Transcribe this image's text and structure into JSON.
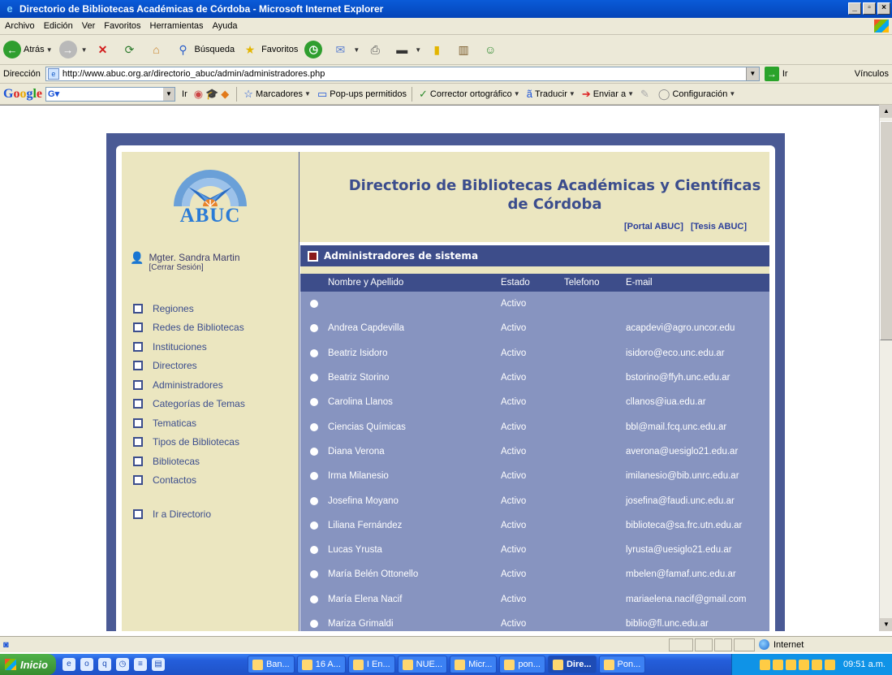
{
  "window": {
    "title": "Directorio de Bibliotecas Académicas de Córdoba - Microsoft Internet Explorer"
  },
  "menubar": [
    "Archivo",
    "Edición",
    "Ver",
    "Favoritos",
    "Herramientas",
    "Ayuda"
  ],
  "toolbar": {
    "back": "Atrás",
    "search": "Búsqueda",
    "favorites": "Favoritos"
  },
  "address": {
    "label": "Dirección",
    "url": "http://www.abuc.org.ar/directorio_abuc/admin/administradores.php",
    "go": "Ir",
    "links": "Vínculos"
  },
  "googlebar": {
    "go": "Ir",
    "bookmarks": "Marcadores",
    "popups": "Pop-ups permitidos",
    "spell": "Corrector ortográfico",
    "translate": "Traducir",
    "send": "Enviar a",
    "settings": "Configuración"
  },
  "site": {
    "logo_text": "ABUC",
    "title": "Directorio de Bibliotecas Académicas y Científicas de Córdoba",
    "link_portal": "[Portal ABUC]",
    "link_tesis": "[Tesis ABUC]"
  },
  "user": {
    "name": "Mgter. Sandra Martin",
    "logout": "[Cerrar Sesión]"
  },
  "sidebar": {
    "items": [
      "Regiones",
      "Redes de Bibliotecas",
      "Instituciones",
      "Directores",
      "Administradores",
      "Categorías de Temas",
      "Tematicas",
      "Tipos de Bibliotecas",
      "Bibliotecas",
      "Contactos"
    ],
    "directory_link": "Ir a Directorio"
  },
  "section": {
    "title": "Administradores de sistema"
  },
  "table": {
    "headers": [
      "Nombre y Apellido",
      "Estado",
      "Telefono",
      "E-mail"
    ],
    "rows": [
      {
        "name": "",
        "estado": "Activo",
        "tel": "",
        "email": ""
      },
      {
        "name": "Andrea Capdevilla",
        "estado": "Activo",
        "tel": "",
        "email": "acapdevi@agro.uncor.edu"
      },
      {
        "name": "Beatriz Isidoro",
        "estado": "Activo",
        "tel": "",
        "email": "isidoro@eco.unc.edu.ar"
      },
      {
        "name": "Beatriz Storino",
        "estado": "Activo",
        "tel": "",
        "email": "bstorino@ffyh.unc.edu.ar"
      },
      {
        "name": "Carolina Llanos",
        "estado": "Activo",
        "tel": "",
        "email": "cllanos@iua.edu.ar"
      },
      {
        "name": "Ciencias Químicas",
        "estado": "Activo",
        "tel": "",
        "email": "bbl@mail.fcq.unc.edu.ar"
      },
      {
        "name": "Diana Verona",
        "estado": "Activo",
        "tel": "",
        "email": "averona@uesiglo21.edu.ar"
      },
      {
        "name": "Irma Milanesio",
        "estado": "Activo",
        "tel": "",
        "email": "imilanesio@bib.unrc.edu.ar"
      },
      {
        "name": "Josefina Moyano",
        "estado": "Activo",
        "tel": "",
        "email": "josefina@faudi.unc.edu.ar"
      },
      {
        "name": "Liliana Fernández",
        "estado": "Activo",
        "tel": "",
        "email": "biblioteca@sa.frc.utn.edu.ar"
      },
      {
        "name": "Lucas Yrusta",
        "estado": "Activo",
        "tel": "",
        "email": "lyrusta@uesiglo21.edu.ar"
      },
      {
        "name": "María Belén Ottonello",
        "estado": "Activo",
        "tel": "",
        "email": "mbelen@famaf.unc.edu.ar"
      },
      {
        "name": "María Elena Nacif",
        "estado": "Activo",
        "tel": "",
        "email": "mariaelena.nacif@gmail.com"
      },
      {
        "name": "Mariza Grimaldi",
        "estado": "Activo",
        "tel": "",
        "email": "biblio@fl.unc.edu.ar"
      }
    ]
  },
  "statusbar": {
    "zone": "Internet"
  },
  "taskbar": {
    "start": "Inicio",
    "tasks": [
      "Ban...",
      "16 A...",
      "I En...",
      "NUE...",
      "Micr...",
      "pon...",
      "Dire...",
      "Pon..."
    ],
    "clock": "09:51 a.m."
  }
}
